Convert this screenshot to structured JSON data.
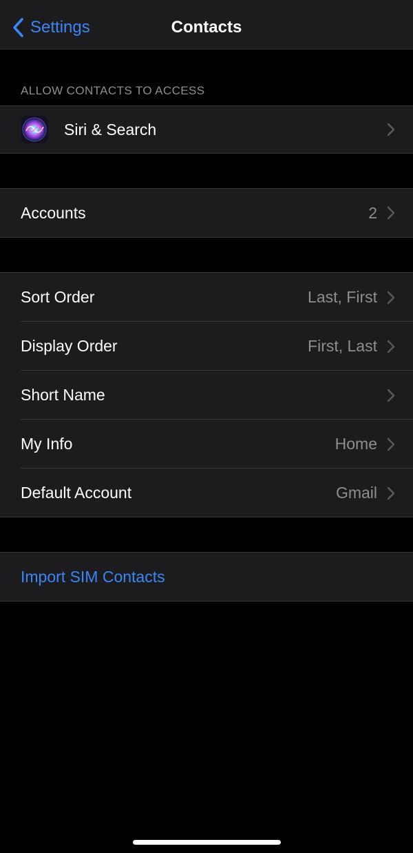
{
  "navbar": {
    "back_label": "Settings",
    "title": "Contacts",
    "back_icon": "chevron-left-icon"
  },
  "allow_access": {
    "header": "ALLOW CONTACTS TO ACCESS",
    "siri": {
      "label": "Siri & Search",
      "icon": "siri-icon"
    }
  },
  "accounts": {
    "label": "Accounts",
    "value": "2"
  },
  "settings": {
    "sort_order": {
      "label": "Sort Order",
      "value": "Last, First"
    },
    "display_order": {
      "label": "Display Order",
      "value": "First, Last"
    },
    "short_name": {
      "label": "Short Name"
    },
    "my_info": {
      "label": "My Info",
      "value": "Home"
    },
    "default_account": {
      "label": "Default Account",
      "value": "Gmail"
    }
  },
  "import": {
    "label": "Import SIM Contacts"
  },
  "colors": {
    "accent": "#3b86f7",
    "background": "#000000",
    "cell_background": "#1c1c1e",
    "secondary_text": "#8e8e93"
  }
}
